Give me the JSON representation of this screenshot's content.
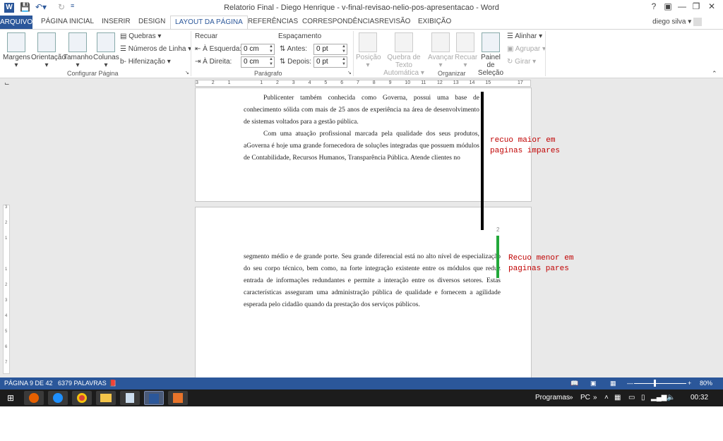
{
  "window": {
    "title": "Relatorio Final - Diego Henrique - v-final-revisao-nelio-pos-apresentacao - Word",
    "help_label": "?",
    "minimize_label": "—",
    "restore_label": "❐",
    "close_label": "✕",
    "word_icon_label": "W"
  },
  "tabs": [
    "ARQUIVO",
    "PÁGINA INICIAL",
    "INSERIR",
    "DESIGN",
    "LAYOUT DA PÁGINA",
    "REFERÊNCIAS",
    "CORRESPONDÊNCIAS",
    "REVISÃO",
    "EXIBIÇÃO"
  ],
  "user": "diego silva",
  "ribbon": {
    "configurar": {
      "margens": "Margens",
      "orientacao": "Orientação",
      "tamanho": "Tamanho",
      "colunas": "Colunas",
      "quebras": "Quebras",
      "numeros": "Números de Linha",
      "hifenizacao": "Hifenização",
      "group_label": "Configurar Página"
    },
    "paragrafo": {
      "recuar": "Recuar",
      "espacamento": "Espaçamento",
      "esquerda_label": "À Esquerda:",
      "esquerda_value": "0 cm",
      "direita_label": "À Direita:",
      "direita_value": "0 cm",
      "antes_label": "Antes:",
      "antes_value": "0 pt",
      "depois_label": "Depois:",
      "depois_value": "0 pt",
      "group_label": "Parágrafo"
    },
    "organizar": {
      "posicao": "Posição",
      "quebra": "Quebra de Texto Automática",
      "avancar": "Avançar",
      "recuar": "Recuar",
      "painel": "Painel de Seleção",
      "alinhar": "Alinhar",
      "agrupar": "Agrupar",
      "girar": "Girar",
      "group_label": "Organizar"
    }
  },
  "ruler_ticks": [
    "3",
    "2",
    "1",
    "",
    "1",
    "2",
    "3",
    "4",
    "5",
    "6",
    "7",
    "8",
    "9",
    "10",
    "11",
    "12",
    "13",
    "14",
    "15",
    "",
    "17"
  ],
  "vruler_ticks": [
    "3",
    "2",
    "1",
    "",
    "1",
    "2",
    "3",
    "4",
    "5",
    "6",
    "7"
  ],
  "document": {
    "page1": {
      "paragraphs": [
        "Publicenter também conhecida como Governa, possui uma base de conhecimento sólida com mais de 25 anos de experiência na área de desenvolvimento de sistemas voltados para a gestão pública.",
        "Com uma atuação profissional marcada pela qualidade dos seus produtos, aGoverna é hoje uma grande fornecedora de soluções integradas que possuem módulos de Contabilidade, Recursos Humanos, Transparência Pública. Atende clientes no"
      ]
    },
    "page2": {
      "page_number": "2",
      "paragraphs": [
        "segmento médio e de grande porte. Seu grande diferencial está no alto nível de especialização do seu corpo técnico, bem como, na forte integração existente entre os módulos que reduz entrada de informações redundantes e permite a interação entre os diversos setores. Estas características asseguram uma administração pública de qualidade e fornecem a agilidade esperada pelo cidadão quando da prestação dos serviços públicos."
      ]
    }
  },
  "annotations": {
    "black": {
      "text": "recuo maior em paginas impares",
      "color": "#000000"
    },
    "green": {
      "text": "Recuo menor em paginas pares",
      "color": "#22a83a"
    }
  },
  "status": {
    "page": "PÁGINA 9 DE 42",
    "words": "6379 PALAVRAS",
    "zoom": "80%"
  },
  "taskbar": {
    "programas": "Programas",
    "pc": "PC",
    "time": "00:32"
  },
  "colors": {
    "accent": "#2b579a",
    "annotation_text": "#c00000"
  }
}
